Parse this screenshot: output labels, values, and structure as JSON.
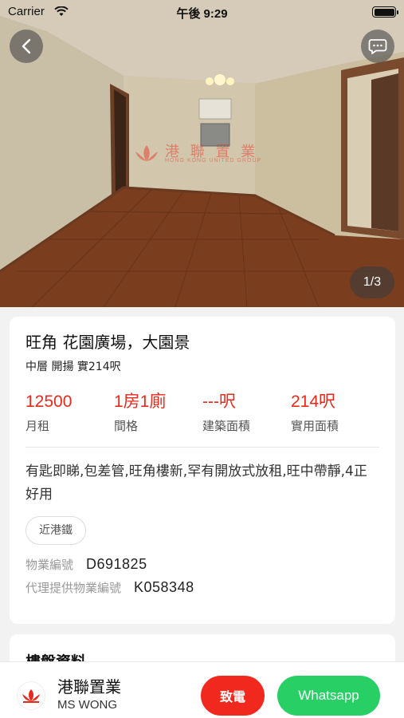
{
  "status_bar": {
    "carrier": "Carrier",
    "time": "午後 9:29"
  },
  "gallery": {
    "counter": "1/3",
    "watermark_cn": "港 聯 置 業",
    "watermark_en": "HONG KONG UNITED GROUP"
  },
  "listing": {
    "title": "旺角 花園廣場，大園景",
    "subtitle": "中層 開揚 實214呎",
    "stats": [
      {
        "value": "12500",
        "label": "月租"
      },
      {
        "value": "1房1廁",
        "label": "間格"
      },
      {
        "value": "---呎",
        "label": "建築面積"
      },
      {
        "value": "214呎",
        "label": "實用面積"
      }
    ],
    "description": "有匙即睇,包差管,旺角樓新,罕有開放式放租,旺中帶靜,4正好用",
    "tag": "近港鐵",
    "property_no_label": "物業編號",
    "property_no": "D691825",
    "agent_ref_label": "代理提供物業編號",
    "agent_ref": "K058348"
  },
  "next_section": {
    "title": "樓盤資料"
  },
  "agent": {
    "company": "港聯置業",
    "person": "MS WONG",
    "call_label": "致電",
    "whatsapp_label": "Whatsapp"
  },
  "colors": {
    "accent_red": "#e8291c",
    "whatsapp_green": "#27cf64"
  }
}
